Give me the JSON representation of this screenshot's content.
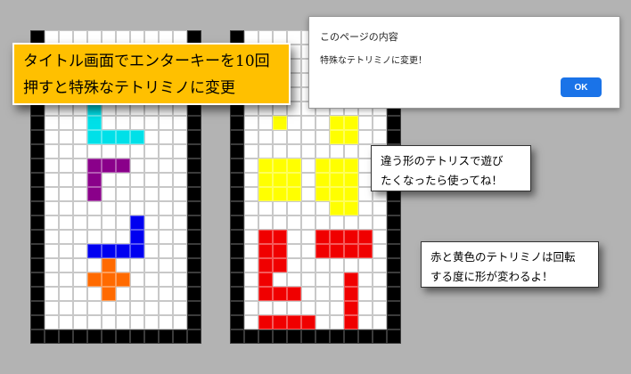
{
  "title_note": {
    "line1": "タイトル画面でエンターキーを10回",
    "line2": "押すと特殊なテトリミノに変更"
  },
  "note_play": {
    "line1": "違う形のテトリスで遊び",
    "line2": "たくなったら使ってね！"
  },
  "note_rotate": {
    "line1": "赤と黄色のテトリミノは回転",
    "line2": "する度に形が変わるよ！"
  },
  "dialog": {
    "title": "このページの内容",
    "message": "特殊なテトリミノに変更！",
    "ok_label": "OK"
  },
  "colors": {
    "cyan": "#00e0e8",
    "purple": "#8a008a",
    "blue": "#0000f0",
    "orange": "#ff6a00",
    "yellow": "#ffff00",
    "red": "#f00000",
    "title_note_bg": "#ffc000",
    "ok_button": "#1a73e8"
  },
  "boards": [
    {
      "name": "left-board",
      "pieces": [
        {
          "color": "cyan",
          "cells": [
            [
              5,
              4
            ],
            [
              6,
              4
            ],
            [
              7,
              4
            ],
            [
              7,
              5
            ],
            [
              7,
              6
            ],
            [
              7,
              7
            ]
          ]
        },
        {
          "color": "purple",
          "cells": [
            [
              9,
              4
            ],
            [
              9,
              5
            ],
            [
              9,
              6
            ],
            [
              10,
              4
            ],
            [
              11,
              4
            ]
          ]
        },
        {
          "color": "blue",
          "cells": [
            [
              13,
              7
            ],
            [
              14,
              7
            ],
            [
              15,
              4
            ],
            [
              15,
              5
            ],
            [
              15,
              6
            ],
            [
              15,
              7
            ]
          ]
        },
        {
          "color": "orange",
          "cells": [
            [
              16,
              5
            ],
            [
              17,
              4
            ],
            [
              17,
              5
            ],
            [
              17,
              6
            ],
            [
              18,
              5
            ]
          ]
        }
      ]
    },
    {
      "name": "right-board",
      "pieces": [
        {
          "color": "yellow",
          "cells": [
            [
              6,
              3
            ],
            [
              6,
              7
            ],
            [
              6,
              8
            ],
            [
              7,
              7
            ],
            [
              7,
              8
            ]
          ]
        },
        {
          "color": "yellow",
          "cells": [
            [
              9,
              2
            ],
            [
              9,
              3
            ],
            [
              9,
              4
            ],
            [
              10,
              2
            ],
            [
              10,
              3
            ],
            [
              10,
              4
            ],
            [
              11,
              2
            ],
            [
              11,
              3
            ],
            [
              11,
              4
            ]
          ]
        },
        {
          "color": "yellow",
          "cells": [
            [
              9,
              6
            ],
            [
              9,
              7
            ],
            [
              9,
              8
            ],
            [
              10,
              6
            ],
            [
              10,
              7
            ],
            [
              10,
              8
            ],
            [
              11,
              6
            ],
            [
              11,
              7
            ],
            [
              11,
              8
            ],
            [
              12,
              7
            ],
            [
              12,
              8
            ]
          ]
        },
        {
          "color": "red",
          "cells": [
            [
              14,
              2
            ],
            [
              14,
              3
            ],
            [
              15,
              2
            ],
            [
              15,
              3
            ],
            [
              16,
              2
            ],
            [
              16,
              3
            ],
            [
              17,
              2
            ],
            [
              18,
              2
            ],
            [
              18,
              3
            ],
            [
              18,
              4
            ]
          ]
        },
        {
          "color": "red",
          "cells": [
            [
              14,
              6
            ],
            [
              14,
              7
            ],
            [
              14,
              8
            ],
            [
              14,
              9
            ],
            [
              15,
              6
            ],
            [
              15,
              7
            ],
            [
              15,
              8
            ],
            [
              15,
              9
            ]
          ]
        },
        {
          "color": "red",
          "cells": [
            [
              17,
              8
            ],
            [
              18,
              8
            ],
            [
              19,
              8
            ],
            [
              20,
              8
            ]
          ]
        },
        {
          "color": "red",
          "cells": [
            [
              20,
              2
            ],
            [
              20,
              3
            ],
            [
              20,
              4
            ],
            [
              20,
              5
            ]
          ]
        }
      ]
    }
  ]
}
